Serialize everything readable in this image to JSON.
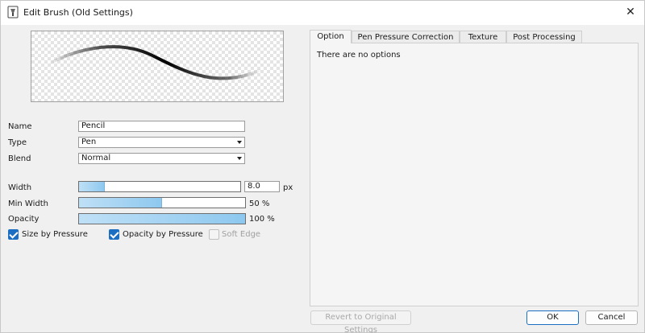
{
  "window": {
    "title": "Edit Brush (Old Settings)"
  },
  "form": {
    "name_label": "Name",
    "name_value": "Pencil",
    "type_label": "Type",
    "type_value": "Pen",
    "blend_label": "Blend",
    "blend_value": "Normal"
  },
  "sliders": {
    "width": {
      "label": "Width",
      "value": "8.0",
      "unit": "px",
      "fill_fraction": 0.16
    },
    "min_width": {
      "label": "Min Width",
      "value": "50 %",
      "fill_fraction": 0.5
    },
    "opacity": {
      "label": "Opacity",
      "value": "100 %",
      "fill_fraction": 1.0
    }
  },
  "checkboxes": [
    {
      "label": "Size by Pressure",
      "checked": true,
      "enabled": true
    },
    {
      "label": "Opacity by Pressure",
      "checked": true,
      "enabled": true
    },
    {
      "label": "Soft Edge",
      "checked": false,
      "enabled": false
    }
  ],
  "tabs": [
    {
      "label": "Option",
      "active": true
    },
    {
      "label": "Pen Pressure Correction",
      "active": false
    },
    {
      "label": "Texture",
      "active": false
    },
    {
      "label": "Post Processing",
      "active": false
    }
  ],
  "panel": {
    "message": "There are no options"
  },
  "buttons": {
    "revert": "Revert to Original Settings",
    "ok": "OK",
    "cancel": "Cancel"
  },
  "icons": {
    "app": "brush-app-icon",
    "close": "close-icon",
    "dropdown": "chevron-down-icon"
  },
  "colors": {
    "accent": "#1b6fc2",
    "slider_fill": "#9fd0f2"
  }
}
